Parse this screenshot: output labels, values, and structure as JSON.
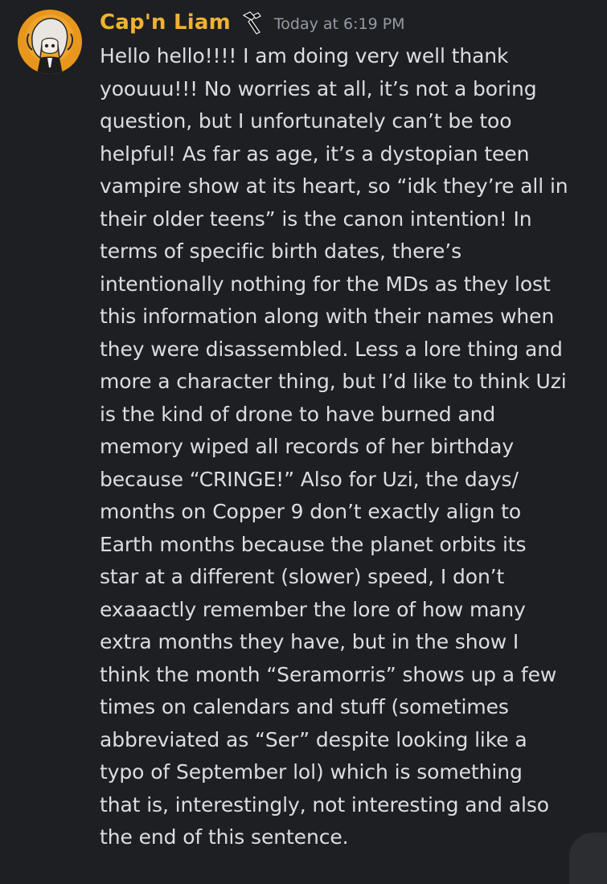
{
  "message": {
    "username": "Cap'n Liam",
    "timestamp": "Today at 6:19 PM",
    "avatar_icon": "anime-character-avatar-icon",
    "role_icon": "hammer-role-icon",
    "colors": {
      "background": "#1e1f22",
      "username": "#f0b232",
      "timestamp": "#949ba4",
      "text": "#dbdee1"
    },
    "lines": [
      "Hello hello!!!! I am doing very well thank",
      "yoouuu!!! No worries at all, it’s not a boring",
      "question, but I unfortunately can’t be too",
      "helpful! As far as age, it’s a dystopian teen",
      "vampire show at its heart, so “idk they’re all in",
      "their older teens” is the canon intention! In",
      "terms of specific birth dates, there’s",
      "intentionally nothing for the MDs as they lost",
      "this information along with their names when",
      "they were disassembled. Less a lore thing and",
      "more a character thing, but I’d like to think Uzi",
      "is the kind of drone to have burned and",
      "memory wiped all records of her birthday",
      "because “CRINGE!” Also for Uzi, the days/",
      "months on Copper 9 don’t exactly align to",
      "Earth months because the planet orbits its",
      "star at a different (slower) speed, I don’t",
      "exaaactly remember the lore of how many",
      "extra months they have, but in the show I",
      "think the month “Seramorris” shows up a few",
      "times on calendars and stuff (sometimes",
      "abbreviated as “Ser” despite looking like a",
      "typo of September lol) which is something",
      "that is, interestingly, not interesting and also",
      "the end of this sentence."
    ]
  }
}
